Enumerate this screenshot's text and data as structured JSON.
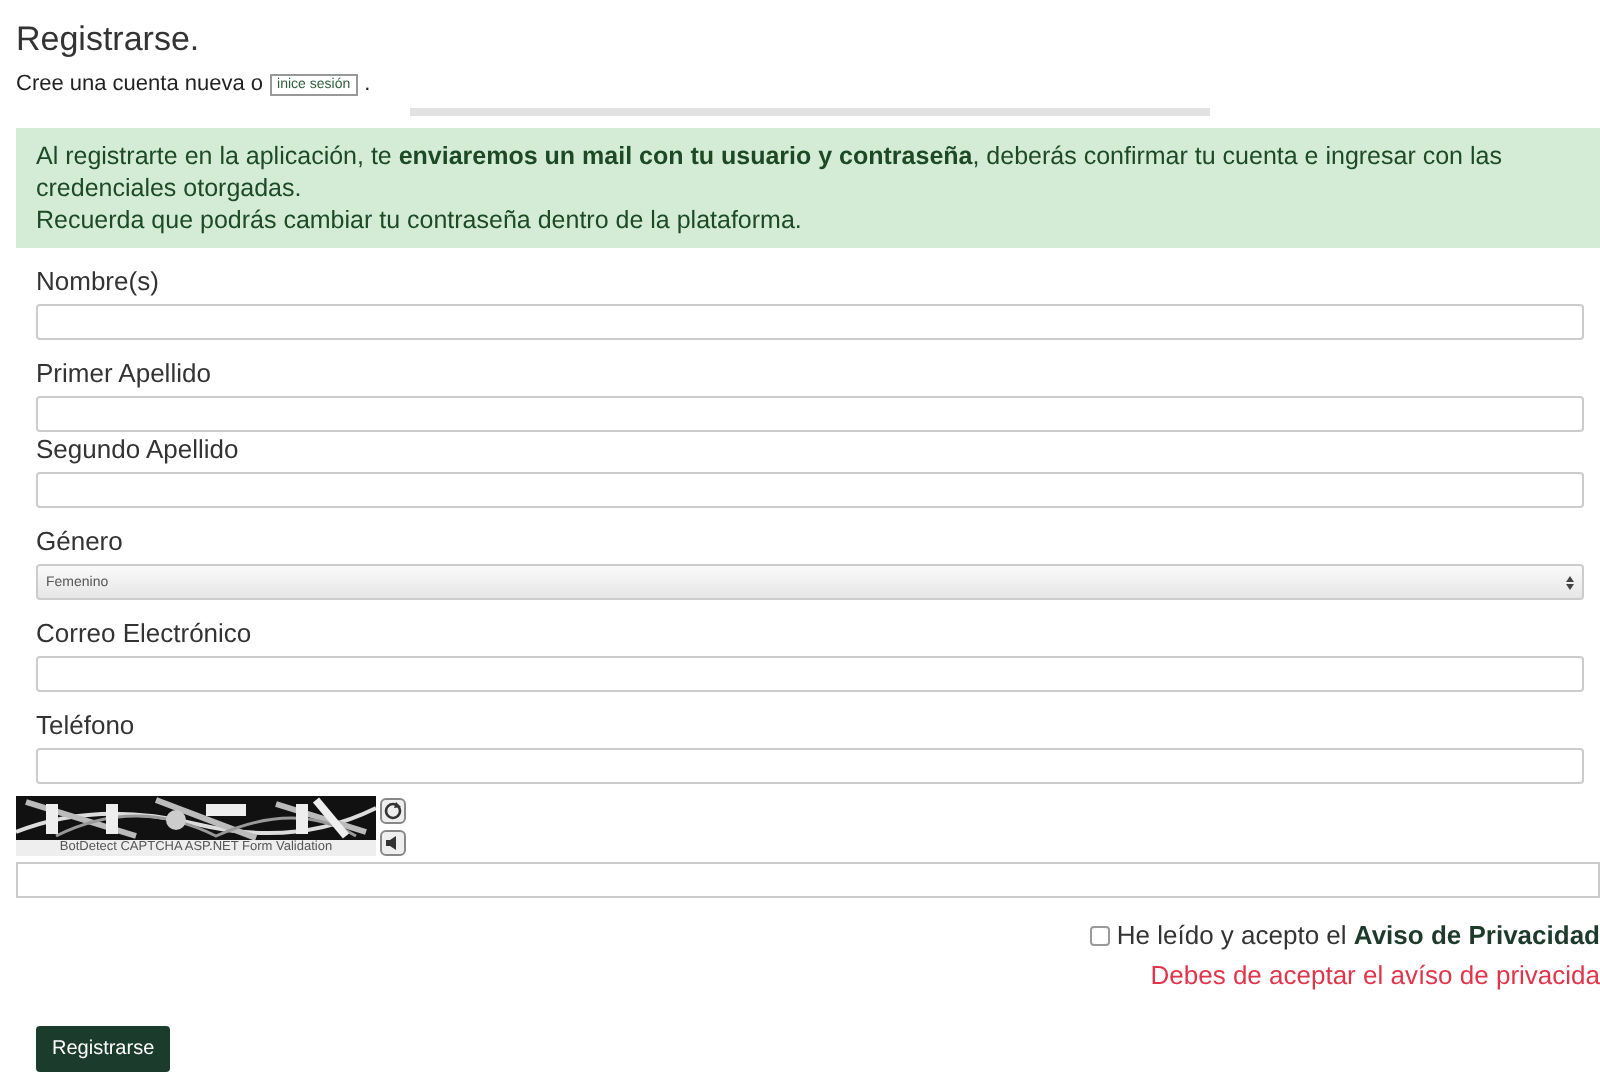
{
  "title": "Registrarse.",
  "subtitle": {
    "text": "Cree una cuenta nueva o",
    "link": "inice sesión",
    "after": "."
  },
  "alert": {
    "lines": [
      "Al registrarte en la aplicación, te **enviaremos un mail con tu usuario y contraseña**, deberás confirmar tu cuenta e ingresar con las credenciales otorgadas.",
      "Recuerda que podrás cambiar tu contraseña dentro de la plataforma."
    ]
  },
  "fields": [
    {
      "kind": "text",
      "label": "Nombre(s)"
    },
    {
      "kind": "text",
      "label": "Primer Apellido"
    },
    {
      "kind": "text",
      "label": "Segundo Apellido"
    },
    {
      "kind": "select",
      "label": "Género",
      "value": "Femenino"
    },
    {
      "kind": "text",
      "label": "Correo Electrónico"
    },
    {
      "kind": "text",
      "label": "Teléfono"
    }
  ],
  "captcha": {
    "caption": "BotDetect CAPTCHA ASP.NET Form Validation"
  },
  "privacy": {
    "checked": false,
    "text": "He leído y acepto el",
    "link": "Aviso de Privacidad",
    "error": "Debes de aceptar el avíso de privacida"
  },
  "submit": "Registrarse"
}
